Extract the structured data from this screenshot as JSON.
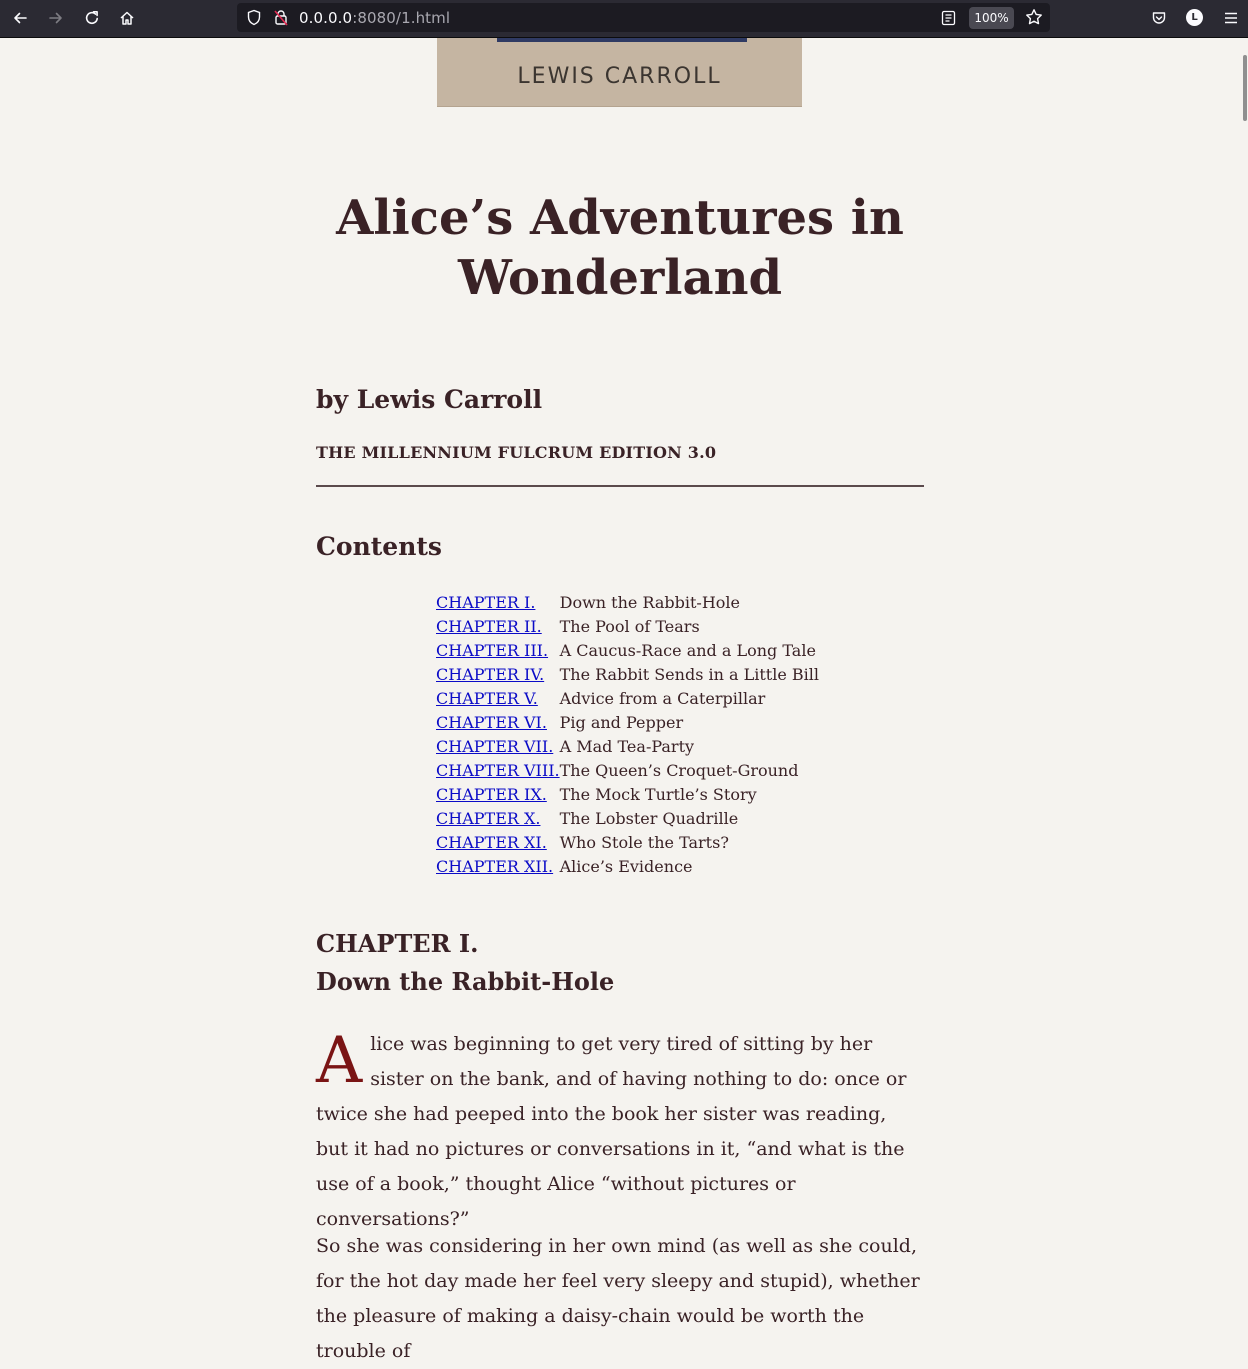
{
  "browser": {
    "url_host": "0.0.0.0",
    "url_rest": ":8080/1.html",
    "zoom": "100%",
    "avatar_letter": "L"
  },
  "cover": {
    "author": "LEWIS CARROLL"
  },
  "book": {
    "title": "Alice’s Adventures in Wonderland",
    "byline": "by Lewis Carroll",
    "edition": "THE MILLENNIUM FULCRUM EDITION 3.0"
  },
  "contents": {
    "heading": "Contents",
    "chapters": [
      {
        "label": "CHAPTER I.",
        "title": "Down the Rabbit-Hole"
      },
      {
        "label": "CHAPTER II.",
        "title": "The Pool of Tears"
      },
      {
        "label": "CHAPTER III.",
        "title": "A Caucus-Race and a Long Tale"
      },
      {
        "label": "CHAPTER IV.",
        "title": "The Rabbit Sends in a Little Bill"
      },
      {
        "label": "CHAPTER V.",
        "title": "Advice from a Caterpillar"
      },
      {
        "label": "CHAPTER VI.",
        "title": "Pig and Pepper"
      },
      {
        "label": "CHAPTER VII.",
        "title": "A Mad Tea-Party"
      },
      {
        "label": "CHAPTER VIII.",
        "title": "The Queen’s Croquet-Ground"
      },
      {
        "label": "CHAPTER IX.",
        "title": "The Mock Turtle’s Story"
      },
      {
        "label": "CHAPTER X.",
        "title": "The Lobster Quadrille"
      },
      {
        "label": "CHAPTER XI.",
        "title": "Who Stole the Tarts?"
      },
      {
        "label": "CHAPTER XII.",
        "title": "Alice’s Evidence"
      }
    ]
  },
  "chapter1": {
    "label": "CHAPTER I.",
    "title": "Down the Rabbit-Hole",
    "dropcap": "A",
    "para1_rest": "lice was beginning to get very tired of sitting by her sister on the bank, and of having nothing to do: once or twice she had peeped into the book her sister was reading, but it had no pictures or conversations in it, “and what is the use of a book,” thought Alice “without pictures or conversations?”",
    "para2": "So she was considering in her own mind (as well as she could, for the hot day made her feel very sleepy and stupid), whether the pleasure of making a daisy-chain would be worth the trouble of"
  }
}
